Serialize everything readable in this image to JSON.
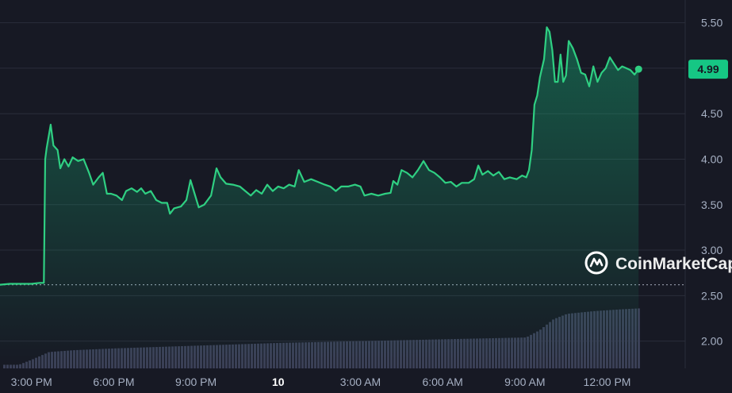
{
  "watermark": {
    "text": "CoinMarketCap",
    "icon": "coinmarketcap-logo-icon"
  },
  "colors": {
    "background": "#171924",
    "line": "#2fcf82",
    "grid": "#2a2d3a",
    "volume": "#3a3f56",
    "label_bg": "#16c784",
    "baseline": "#8a8f9e",
    "text": "#a6b0c3"
  },
  "current_price": {
    "label": "4.99",
    "value": 4.99
  },
  "chart_data": {
    "type": "area",
    "title": "",
    "xlabel": "",
    "ylabel": "",
    "ylim": [
      1.7,
      5.75
    ],
    "y_ticks": [
      "5.50",
      "5.00",
      "4.50",
      "4.00",
      "3.50",
      "3.00",
      "2.50",
      "2.00"
    ],
    "y_tick_values": [
      5.5,
      5.0,
      4.5,
      4.0,
      3.5,
      3.0,
      2.5,
      2.0
    ],
    "x_ticks": [
      "3:00 PM",
      "6:00 PM",
      "9:00 PM",
      "10",
      "3:00 AM",
      "6:00 AM",
      "9:00 AM",
      "12:00 PM"
    ],
    "x_tick_hours": [
      15,
      18,
      21,
      24,
      27,
      30,
      33,
      36
    ],
    "bold_x_tick": "10",
    "xlim_hours": [
      13.85,
      38.85
    ],
    "grid": true,
    "baseline_value": 2.62,
    "series": [
      {
        "points": [
          [
            13.85,
            2.62
          ],
          [
            14.2,
            2.63
          ],
          [
            14.6,
            2.63
          ],
          [
            15.0,
            2.63
          ],
          [
            15.3,
            2.64
          ],
          [
            15.45,
            2.64
          ],
          [
            15.5,
            4.0
          ],
          [
            15.55,
            4.12
          ],
          [
            15.7,
            4.38
          ],
          [
            15.8,
            4.15
          ],
          [
            15.95,
            4.1
          ],
          [
            16.05,
            3.9
          ],
          [
            16.2,
            4.0
          ],
          [
            16.35,
            3.92
          ],
          [
            16.5,
            4.02
          ],
          [
            16.7,
            3.98
          ],
          [
            16.9,
            4.0
          ],
          [
            17.1,
            3.85
          ],
          [
            17.25,
            3.72
          ],
          [
            17.45,
            3.8
          ],
          [
            17.6,
            3.85
          ],
          [
            17.75,
            3.62
          ],
          [
            17.9,
            3.62
          ],
          [
            18.1,
            3.6
          ],
          [
            18.3,
            3.55
          ],
          [
            18.45,
            3.65
          ],
          [
            18.65,
            3.68
          ],
          [
            18.85,
            3.64
          ],
          [
            19.0,
            3.68
          ],
          [
            19.15,
            3.62
          ],
          [
            19.35,
            3.65
          ],
          [
            19.55,
            3.55
          ],
          [
            19.75,
            3.52
          ],
          [
            19.95,
            3.52
          ],
          [
            20.05,
            3.4
          ],
          [
            20.2,
            3.46
          ],
          [
            20.45,
            3.48
          ],
          [
            20.65,
            3.55
          ],
          [
            20.8,
            3.77
          ],
          [
            20.95,
            3.62
          ],
          [
            21.1,
            3.47
          ],
          [
            21.3,
            3.5
          ],
          [
            21.55,
            3.6
          ],
          [
            21.75,
            3.9
          ],
          [
            21.9,
            3.8
          ],
          [
            22.1,
            3.73
          ],
          [
            22.35,
            3.72
          ],
          [
            22.6,
            3.7
          ],
          [
            22.8,
            3.65
          ],
          [
            23.0,
            3.6
          ],
          [
            23.2,
            3.66
          ],
          [
            23.4,
            3.62
          ],
          [
            23.6,
            3.72
          ],
          [
            23.8,
            3.65
          ],
          [
            24.0,
            3.7
          ],
          [
            24.2,
            3.68
          ],
          [
            24.4,
            3.72
          ],
          [
            24.6,
            3.7
          ],
          [
            24.75,
            3.88
          ],
          [
            24.95,
            3.75
          ],
          [
            25.2,
            3.78
          ],
          [
            25.45,
            3.75
          ],
          [
            25.7,
            3.72
          ],
          [
            25.9,
            3.7
          ],
          [
            26.1,
            3.65
          ],
          [
            26.3,
            3.7
          ],
          [
            26.55,
            3.7
          ],
          [
            26.8,
            3.72
          ],
          [
            27.0,
            3.7
          ],
          [
            27.15,
            3.6
          ],
          [
            27.4,
            3.62
          ],
          [
            27.65,
            3.6
          ],
          [
            27.9,
            3.62
          ],
          [
            28.1,
            3.63
          ],
          [
            28.2,
            3.76
          ],
          [
            28.35,
            3.72
          ],
          [
            28.5,
            3.88
          ],
          [
            28.7,
            3.85
          ],
          [
            28.9,
            3.8
          ],
          [
            29.1,
            3.88
          ],
          [
            29.3,
            3.98
          ],
          [
            29.5,
            3.88
          ],
          [
            29.7,
            3.85
          ],
          [
            29.9,
            3.8
          ],
          [
            30.1,
            3.74
          ],
          [
            30.3,
            3.75
          ],
          [
            30.5,
            3.7
          ],
          [
            30.7,
            3.74
          ],
          [
            30.95,
            3.74
          ],
          [
            31.15,
            3.78
          ],
          [
            31.3,
            3.93
          ],
          [
            31.45,
            3.83
          ],
          [
            31.65,
            3.87
          ],
          [
            31.85,
            3.82
          ],
          [
            32.05,
            3.86
          ],
          [
            32.25,
            3.78
          ],
          [
            32.45,
            3.8
          ],
          [
            32.7,
            3.78
          ],
          [
            32.9,
            3.82
          ],
          [
            33.05,
            3.8
          ],
          [
            33.15,
            3.88
          ],
          [
            33.25,
            4.1
          ],
          [
            33.35,
            4.6
          ],
          [
            33.45,
            4.7
          ],
          [
            33.55,
            4.9
          ],
          [
            33.7,
            5.1
          ],
          [
            33.8,
            5.45
          ],
          [
            33.9,
            5.4
          ],
          [
            34.0,
            5.2
          ],
          [
            34.1,
            4.85
          ],
          [
            34.2,
            4.85
          ],
          [
            34.3,
            5.15
          ],
          [
            34.4,
            4.85
          ],
          [
            34.5,
            4.92
          ],
          [
            34.6,
            5.3
          ],
          [
            34.75,
            5.22
          ],
          [
            34.9,
            5.1
          ],
          [
            35.05,
            4.95
          ],
          [
            35.2,
            4.93
          ],
          [
            35.35,
            4.8
          ],
          [
            35.5,
            5.02
          ],
          [
            35.65,
            4.85
          ],
          [
            35.8,
            4.95
          ],
          [
            35.95,
            5.0
          ],
          [
            36.1,
            5.12
          ],
          [
            36.25,
            5.05
          ],
          [
            36.4,
            4.98
          ],
          [
            36.55,
            5.02
          ],
          [
            36.7,
            5.0
          ],
          [
            36.85,
            4.98
          ],
          [
            37.0,
            4.93
          ],
          [
            37.15,
            4.99
          ]
        ]
      }
    ],
    "volume_series": [
      [
        13.85,
        1.74
      ],
      [
        14.5,
        1.74
      ],
      [
        15.0,
        1.8
      ],
      [
        15.6,
        1.88
      ],
      [
        16.5,
        1.9
      ],
      [
        18.0,
        1.92
      ],
      [
        21.0,
        1.95
      ],
      [
        24.0,
        1.98
      ],
      [
        27.0,
        2.0
      ],
      [
        30.0,
        2.02
      ],
      [
        33.0,
        2.04
      ],
      [
        33.5,
        2.12
      ],
      [
        34.0,
        2.24
      ],
      [
        34.5,
        2.3
      ],
      [
        35.5,
        2.33
      ],
      [
        36.5,
        2.35
      ],
      [
        37.15,
        2.36
      ]
    ]
  }
}
